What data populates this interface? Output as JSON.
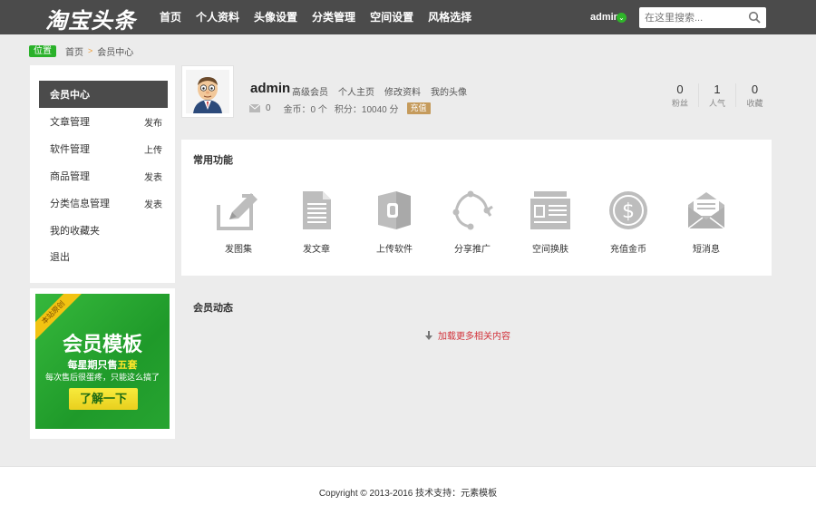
{
  "header": {
    "logo": "淘宝头条",
    "nav": [
      "首页",
      "个人资料",
      "头像设置",
      "分类管理",
      "空间设置",
      "风格选择"
    ],
    "user": "admin",
    "search_placeholder": "在这里搜索..."
  },
  "breadcrumb": {
    "tag": "位置",
    "home": "首页",
    "sep": ">",
    "current": "会员中心"
  },
  "sidebar": {
    "items": [
      {
        "label": "会员中心",
        "sub": ""
      },
      {
        "label": "文章管理",
        "sub": "发布"
      },
      {
        "label": "软件管理",
        "sub": "上传"
      },
      {
        "label": "商品管理",
        "sub": "发表"
      },
      {
        "label": "分类信息管理",
        "sub": "发表"
      },
      {
        "label": "我的收藏夹",
        "sub": ""
      },
      {
        "label": "退出",
        "sub": ""
      }
    ]
  },
  "promo": {
    "ribbon": "本站原创",
    "title": "会员模板",
    "line1_pre": "每星期只售",
    "line1_hl": "五套",
    "line2": "每次售后很蛋疼，只能这么搞了",
    "button": "了解一下"
  },
  "profile": {
    "name": "admin",
    "links": [
      "高级会员",
      "个人主页",
      "修改资料",
      "我的头像"
    ],
    "messages": "0",
    "coins": "金币：0 个",
    "points": "积分：10040 分",
    "recharge": "充值",
    "stats": [
      {
        "value": "0",
        "label": "粉丝"
      },
      {
        "value": "1",
        "label": "人气"
      },
      {
        "value": "0",
        "label": "收藏"
      }
    ]
  },
  "functions": {
    "title": "常用功能",
    "items": [
      {
        "label": "发图集",
        "icon": "edit-icon"
      },
      {
        "label": "发文章",
        "icon": "document-icon"
      },
      {
        "label": "上传软件",
        "icon": "software-icon"
      },
      {
        "label": "分享推广",
        "icon": "share-icon"
      },
      {
        "label": "空间换肤",
        "icon": "id-card-icon"
      },
      {
        "label": "充值金币",
        "icon": "coin-icon"
      },
      {
        "label": "短消息",
        "icon": "mail-icon"
      }
    ]
  },
  "activity": {
    "title": "会员动态",
    "load_more": "加载更多相关内容"
  },
  "footer": {
    "copyright": "Copyright © 2013-2016 技术支持：元素模板"
  }
}
